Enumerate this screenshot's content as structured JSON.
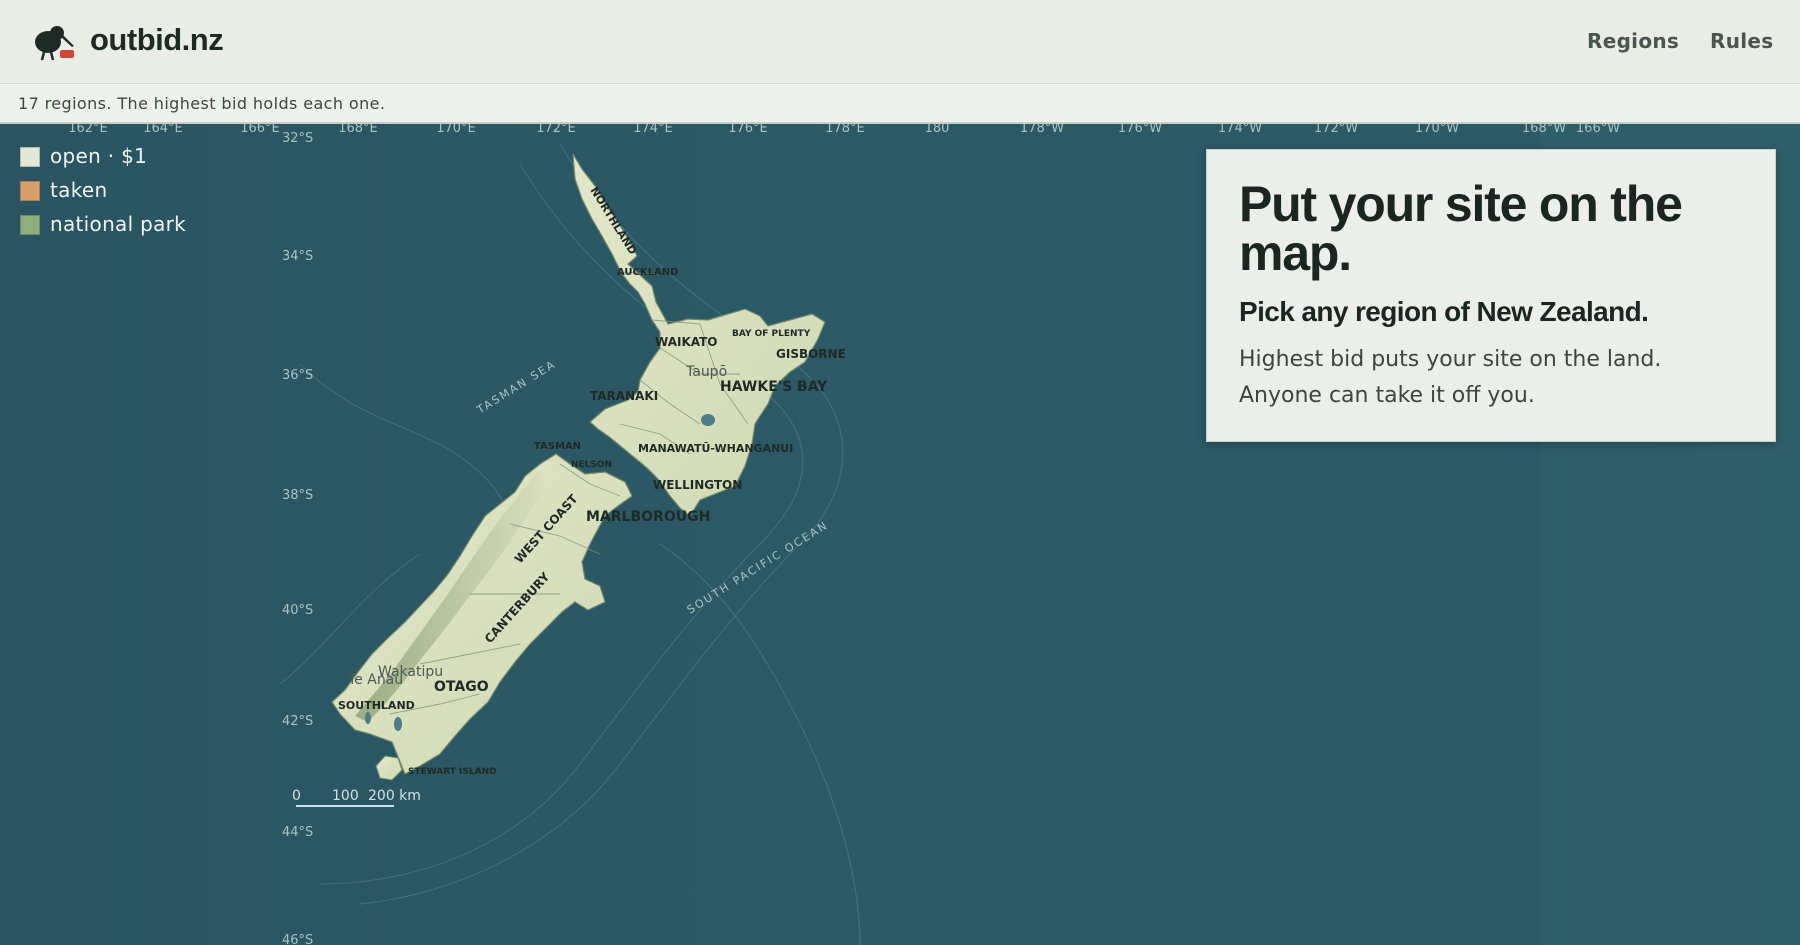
{
  "header": {
    "brand": "outbid.nz",
    "logo_icon": "kiwi-bird-icon",
    "nav": [
      {
        "label": "Regions"
      },
      {
        "label": "Rules"
      }
    ]
  },
  "infobar": {
    "text": "17 regions. The highest bid holds each one."
  },
  "legend": [
    {
      "label": "open · $1",
      "color": "#e3e8d6"
    },
    {
      "label": "taken",
      "color": "#d7a06a"
    },
    {
      "label": "national park",
      "color": "#8fae7d"
    }
  ],
  "card": {
    "title": "Put your site on the map.",
    "subtitle": "Pick any region of New Zealand.",
    "body_line1": "Highest bid puts your site on the land.",
    "body_line2": "Anyone can take it off you."
  },
  "map": {
    "colors": {
      "ocean": "#2b5663",
      "land": "#dfe3c4",
      "land_dark": "#b9c59a",
      "grid_text": "#a9c2c6"
    },
    "longitude_labels": [
      "162°E",
      "164°E",
      "166°E",
      "168°E",
      "170°E",
      "172°E",
      "174°E",
      "176°E",
      "178°E",
      "180",
      "178°W",
      "176°W",
      "174°W",
      "172°W",
      "170°W",
      "168°W",
      "166°W"
    ],
    "latitude_labels": [
      "32°S",
      "34°S",
      "36°S",
      "38°S",
      "40°S",
      "42°S",
      "44°S",
      "46°S"
    ],
    "sea_labels": [
      "TASMAN SEA",
      "SOUTH PACIFIC OCEAN"
    ],
    "regions": [
      {
        "label": "NORTHLAND"
      },
      {
        "label": "AUCKLAND"
      },
      {
        "label": "WAIKATO"
      },
      {
        "label": "BAY OF PLENTY"
      },
      {
        "label": "GISBORNE"
      },
      {
        "label": "HAWKE'S BAY"
      },
      {
        "label": "TARANAKI"
      },
      {
        "label": "MANAWATŪ-WHANGANUI"
      },
      {
        "label": "WELLINGTON"
      },
      {
        "label": "TASMAN"
      },
      {
        "label": "NELSON"
      },
      {
        "label": "MARLBOROUGH"
      },
      {
        "label": "WEST COAST"
      },
      {
        "label": "CANTERBURY"
      },
      {
        "label": "OTAGO"
      },
      {
        "label": "SOUTHLAND"
      },
      {
        "label": "STEWART ISLAND"
      }
    ],
    "lakes": [
      "Taupō",
      "Wakatipu",
      "Te Anau"
    ],
    "scale": {
      "labels": [
        "0",
        "100",
        "200 km"
      ]
    }
  }
}
